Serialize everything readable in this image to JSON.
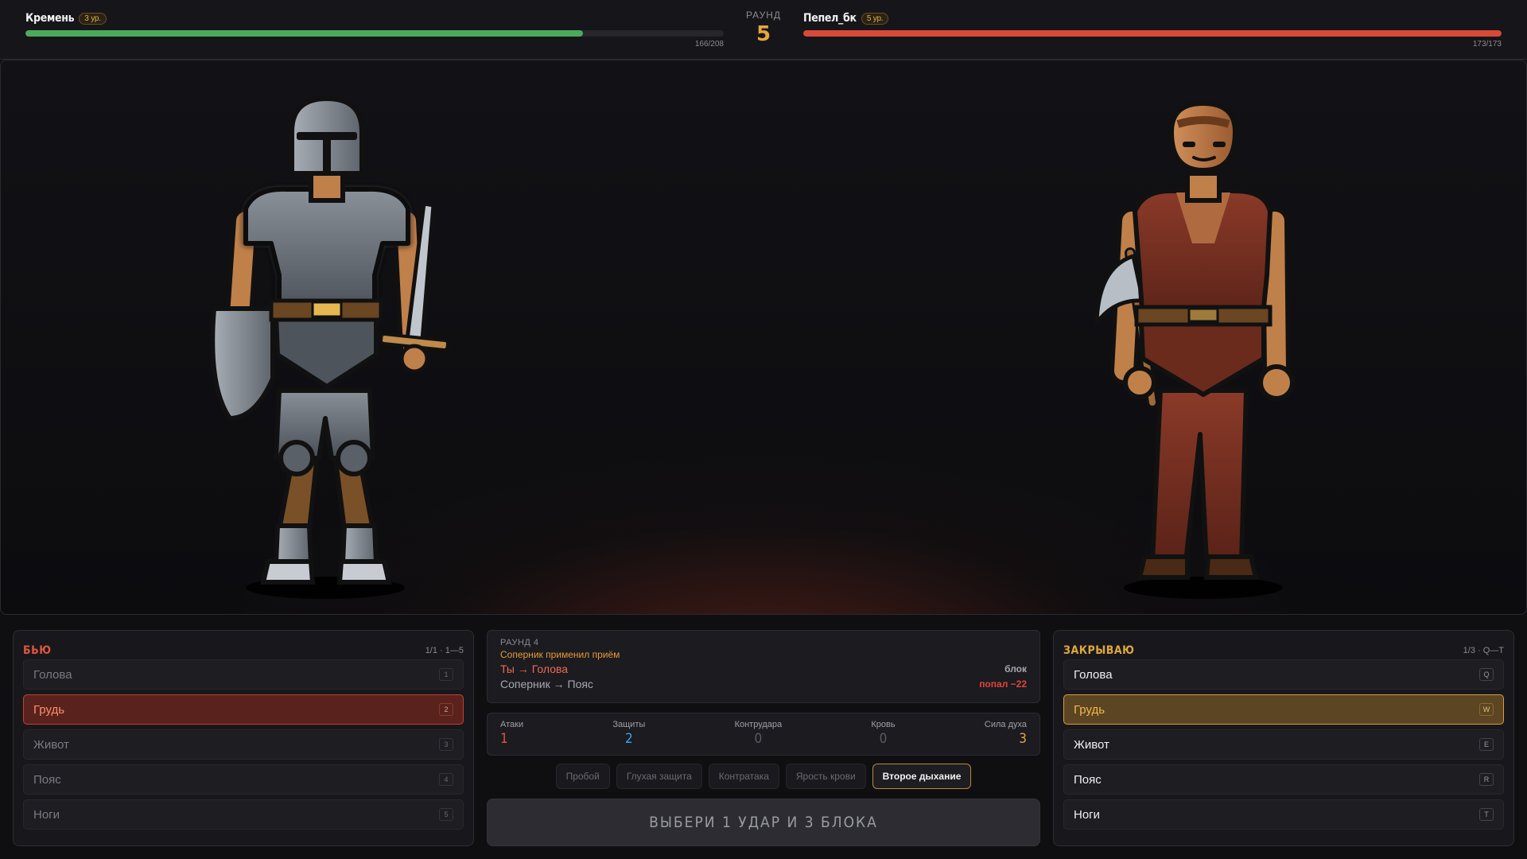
{
  "hud": {
    "player": {
      "name": "Кремень",
      "level": "3 ур.",
      "hp_text": "166/208",
      "hp_fraction": 0.798
    },
    "opponent": {
      "name": "Пепел_бк",
      "level": "5 ур.",
      "hp_text": "173/173",
      "hp_fraction": 1.0
    },
    "round_label": "РАУНД",
    "round_number": "5"
  },
  "attack_panel": {
    "title": "БЬЮ",
    "hint": "1/1 · 1—5",
    "zones": [
      {
        "label": "Голова",
        "key": "1",
        "selected": false
      },
      {
        "label": "Грудь",
        "key": "2",
        "selected": true
      },
      {
        "label": "Живот",
        "key": "3",
        "selected": false
      },
      {
        "label": "Пояс",
        "key": "4",
        "selected": false
      },
      {
        "label": "Ноги",
        "key": "5",
        "selected": false
      }
    ]
  },
  "block_panel": {
    "title": "ЗАКРЫВАЮ",
    "hint": "1/3 · Q—T",
    "zones": [
      {
        "label": "Голова",
        "key": "Q",
        "selected": false
      },
      {
        "label": "Грудь",
        "key": "W",
        "selected": true
      },
      {
        "label": "Живот",
        "key": "E",
        "selected": false
      },
      {
        "label": "Пояс",
        "key": "R",
        "selected": false
      },
      {
        "label": "Ноги",
        "key": "T",
        "selected": false
      }
    ]
  },
  "log": {
    "round": "РАУНД 4",
    "note": "Соперник применил приём",
    "line1": {
      "left": "Ты → Голова",
      "right": "блок"
    },
    "line2": {
      "left": "Соперник → Пояс",
      "right": "попал −22"
    }
  },
  "stats": [
    {
      "label": "Атаки",
      "value": "1",
      "color": "#e0553f"
    },
    {
      "label": "Защиты",
      "value": "2",
      "color": "#3aa8e8"
    },
    {
      "label": "Контрудара",
      "value": "0",
      "color": "#5a5a62"
    },
    {
      "label": "Кровь",
      "value": "0",
      "color": "#5a5a62"
    },
    {
      "label": "Сила духа",
      "value": "3",
      "color": "#e6a63c"
    }
  ],
  "techniques": [
    {
      "label": "Пробой",
      "active": false
    },
    {
      "label": "Глухая защита",
      "active": false
    },
    {
      "label": "Контратака",
      "active": false
    },
    {
      "label": "Ярость крови",
      "active": false
    },
    {
      "label": "Второе дыхание",
      "active": true
    }
  ],
  "action_button": "ВЫБЕРИ 1 УДАР И 3 БЛОКА"
}
